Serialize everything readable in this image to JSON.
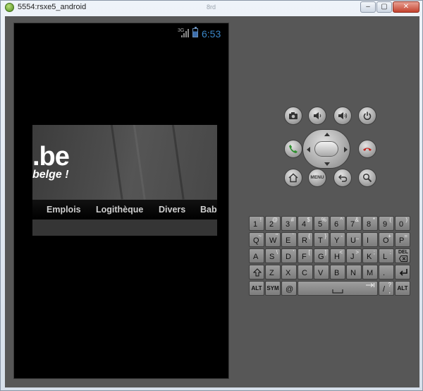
{
  "window": {
    "title": "5554:rsxe5_android",
    "ghost_title": "8rd",
    "minimize_label": "–",
    "maximize_label": "▢",
    "close_label": "✕"
  },
  "status_bar": {
    "network": "3G",
    "time": "6:53"
  },
  "webpage": {
    "logo": ".be",
    "tagline": "belge !",
    "menu": [
      "Emplois",
      "Logithèque",
      "Divers",
      "Bab"
    ]
  },
  "controls": {
    "menu_label": "MENU",
    "icons": [
      "camera-icon",
      "volume-down-icon",
      "volume-up-icon",
      "power-icon",
      "call-icon",
      "end-call-icon",
      "home-icon",
      "back-icon",
      "search-icon"
    ]
  },
  "keyboard": {
    "row1": [
      [
        "1",
        "!"
      ],
      [
        "2",
        "@"
      ],
      [
        "3",
        "#"
      ],
      [
        "4",
        "$"
      ],
      [
        "5",
        "%"
      ],
      [
        "6",
        "^"
      ],
      [
        "7",
        "&"
      ],
      [
        "8",
        "*"
      ],
      [
        "9",
        "("
      ],
      [
        "0",
        ")"
      ]
    ],
    "row2": [
      [
        "Q",
        "~"
      ],
      [
        "W",
        "\""
      ],
      [
        "E",
        "`"
      ],
      [
        "R",
        "{"
      ],
      [
        "T",
        "}"
      ],
      [
        "Y",
        "-"
      ],
      [
        "U",
        "_"
      ],
      [
        "I",
        ""
      ],
      [
        "O",
        "+"
      ],
      [
        "P",
        "="
      ]
    ],
    "row3": [
      [
        "A",
        ""
      ],
      [
        "S",
        "\\"
      ],
      [
        "D",
        "'"
      ],
      [
        "F",
        "["
      ],
      [
        "G",
        "]"
      ],
      [
        "H",
        "<"
      ],
      [
        "J",
        ">"
      ],
      [
        "K",
        ";"
      ],
      [
        "L",
        ":"
      ]
    ],
    "del_label": "DEL",
    "row4": [
      [
        "Z",
        ""
      ],
      [
        "X",
        ""
      ],
      [
        "C",
        ""
      ],
      [
        "V",
        ""
      ],
      [
        "B",
        ""
      ],
      [
        "N",
        ""
      ],
      [
        "M",
        ""
      ],
      [
        ".",
        ""
      ]
    ],
    "alt_label": "ALT",
    "sym_label": "SYM",
    "at_label": "@",
    "slash_label": "/",
    "question_label": "?",
    "comma_label": ","
  }
}
